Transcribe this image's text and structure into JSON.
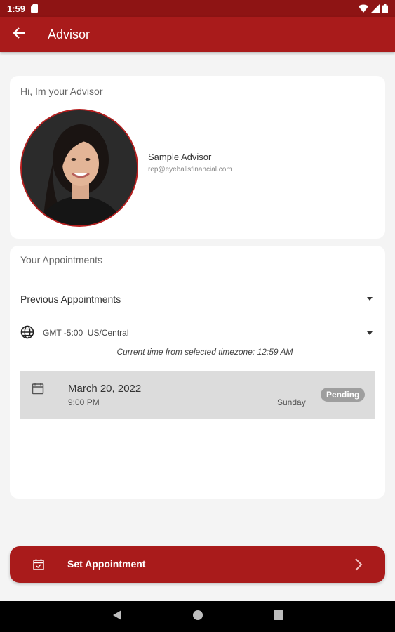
{
  "status_bar": {
    "time": "1:59",
    "icons": [
      "sd-card-icon",
      "wifi-icon",
      "signal-icon",
      "battery-icon"
    ]
  },
  "app_bar": {
    "title": "Advisor",
    "back_icon": "arrow-back-icon",
    "color": "#a91b1b"
  },
  "advisor": {
    "heading": "Hi, Im your Advisor",
    "name": "Sample Advisor",
    "email": "rep@eyeballsfinancial.com"
  },
  "appointments": {
    "heading": "Your Appointments",
    "filter_selected": "Previous Appointments",
    "timezone": {
      "icon": "globe-icon",
      "label": "GMT -5:00  US/Central",
      "current_time_text": "Current time from selected timezone: 12:59 AM"
    },
    "items": [
      {
        "date": "March 20, 2022",
        "time": "9:00 PM",
        "day": "Sunday",
        "status": "Pending"
      }
    ]
  },
  "set_appointment": {
    "label": "Set Appointment",
    "icon": "calendar-check-icon"
  },
  "nav_bar": {
    "icons": [
      "nav-back-icon",
      "nav-home-icon",
      "nav-recents-icon"
    ]
  },
  "colors": {
    "primary": "#a91b1b",
    "status_bar": "#8e1414",
    "badge": "#9e9e9e"
  }
}
